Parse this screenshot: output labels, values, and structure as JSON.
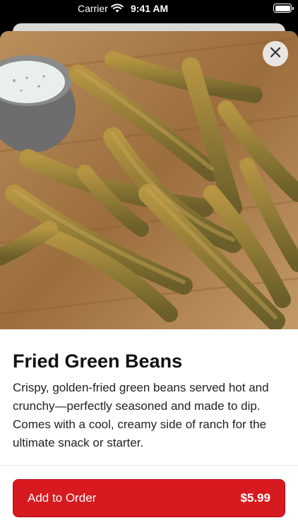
{
  "status_bar": {
    "carrier": "Carrier",
    "time": "9:41 AM",
    "icons": [
      "wifi-icon",
      "battery-icon"
    ]
  },
  "item": {
    "image_label": "Fried green beans with ranch dip",
    "title": "Fried Green Beans",
    "description": "Crispy, golden-fried green beans served hot and crunchy—perfectly seasoned and made to dip. Comes with a cool, creamy side of ranch for the ultimate snack or starter.",
    "close_icon": "close-icon"
  },
  "order_button": {
    "label": "Add to Order",
    "price": "$5.99",
    "color": "#d71920"
  }
}
